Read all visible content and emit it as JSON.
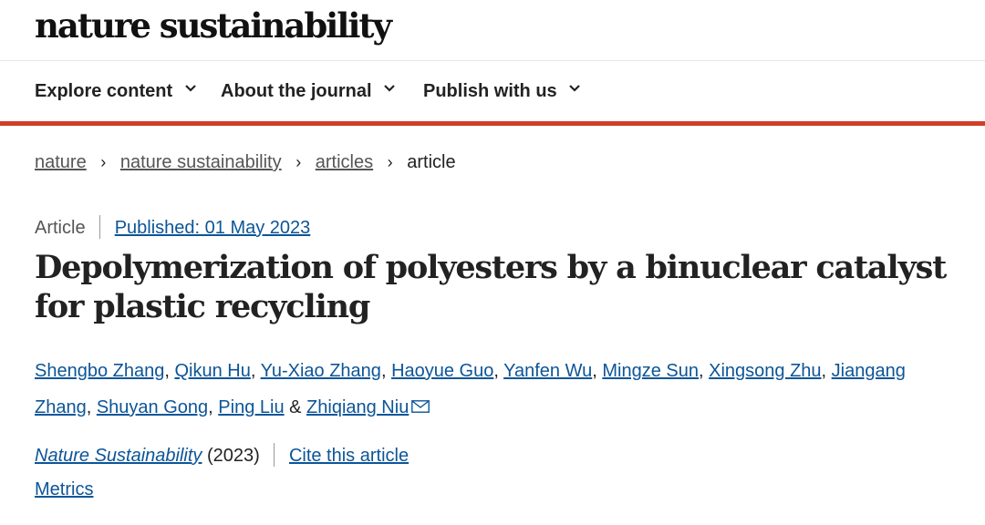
{
  "site": {
    "logo": "nature sustainability"
  },
  "nav": {
    "items": [
      {
        "label": "Explore content"
      },
      {
        "label": "About the journal"
      },
      {
        "label": "Publish with us"
      }
    ]
  },
  "breadcrumb": {
    "items": [
      "nature",
      "nature sustainability",
      "articles"
    ],
    "current": "article"
  },
  "article": {
    "type": "Article",
    "published": "Published: 01 May 2023",
    "title_line1": "Depolymerization of polyesters by a binuclear catalyst",
    "title_line2": "for plastic recycling",
    "authors": [
      "Shengbo Zhang",
      "Qikun Hu",
      "Yu-Xiao Zhang",
      "Haoyue Guo",
      "Yanfen Wu",
      "Mingze Sun",
      "Xingsong Zhu",
      "Jiangang Zhang",
      "Shuyan Gong",
      "Ping Liu",
      "Zhiqiang Niu"
    ],
    "journal": "Nature Sustainability",
    "year": "(2023)",
    "cite_label": "Cite this article",
    "metrics_label": "Metrics"
  },
  "colors": {
    "accent_rule": "#cf3f29",
    "link": "#0c5597"
  },
  "icons": {
    "nav_chevron": "chevron-down-icon",
    "crumb_sep": "chevron-right-icon",
    "mail": "mail-icon"
  }
}
